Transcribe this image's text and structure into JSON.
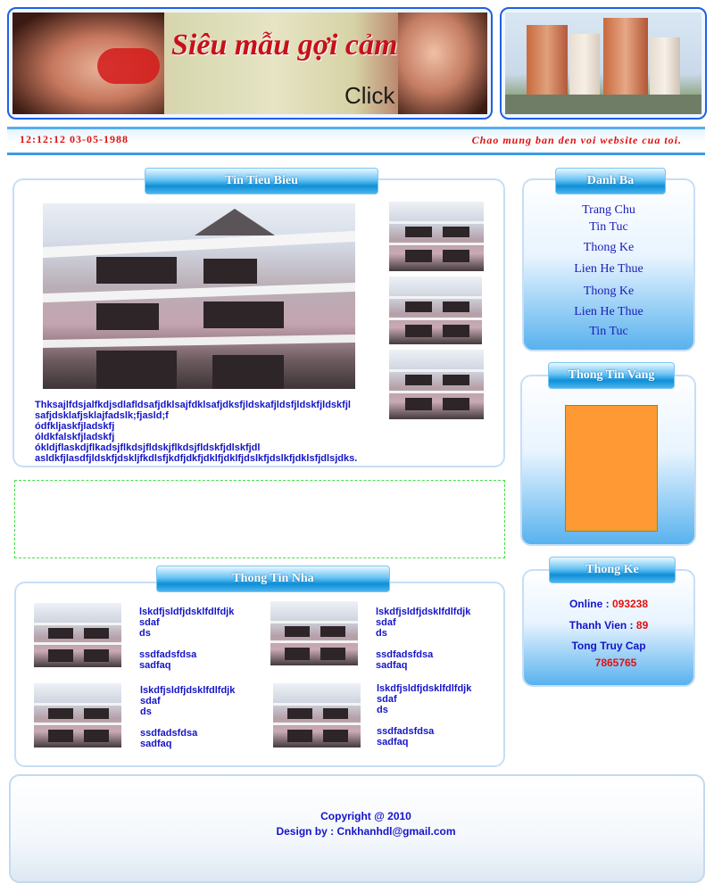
{
  "header": {
    "banner_title": "Siêu mẫu gợi cảm",
    "banner_click": "Click",
    "clock": "12:12:12 03-05-1988",
    "marquee": "Chao mung ban den voi website cua toi."
  },
  "featured": {
    "title": "Tin Tieu Bieu",
    "lines": [
      "Thksajlfdsjalfkdjsdlafldsafjdklsajfdklsafjdksfjldskafjldsfjldskfjldskfjl",
      "safjdsklafjsklajfadslk;fjasld;f",
      "ódfkljaskfjladskfj",
      "óldkfalskfjladskfj",
      "ókldjflaskdjflkadsjflkdsjfldskjflkdsjfldskfjdlskfjdl",
      "asldkfjlasdfjldskfjdskljfkdlsfjkdfjdkfjdklfjdklfjdslkfjdslkfjdklsfjdlsjdks."
    ]
  },
  "houses": {
    "title": "Thong Tin Nha",
    "items": [
      {
        "l1": "lskdfjsldfjdsklfdlfdjk",
        "l2": "sdaf",
        "l3": "ds",
        "l4": "ssdfadsfdsa",
        "l5": "sadfaq"
      },
      {
        "l1": "lskdfjsldfjdsklfdlfdjk",
        "l2": "sdaf",
        "l3": "ds",
        "l4": "ssdfadsfdsa",
        "l5": "sadfaq"
      },
      {
        "l1": "lskdfjsldfjdsklfdlfdjk",
        "l2": "sdaf",
        "l3": "ds",
        "l4": "ssdfadsfdsa",
        "l5": "sadfaq"
      },
      {
        "l1": "lskdfjsldfjdsklfdlfdjk",
        "l2": "sdaf",
        "l3": "ds",
        "l4": "ssdfadsfdsa",
        "l5": "sadfaq"
      }
    ]
  },
  "directory": {
    "title": "Danh Ba",
    "links": [
      "Trang Chu",
      "Tin Tuc",
      "Thong Ke",
      "Lien He Thue",
      "Thong Ke",
      "Lien He Thue",
      "Tin Tuc"
    ]
  },
  "yellow_pages": {
    "title": "Thong Tin Vang",
    "ad_color": "#ff9933"
  },
  "stats": {
    "title": "Thong Ke",
    "online_label": "Online :",
    "online_value": "093238",
    "members_label": "Thanh Vien :",
    "members_value": "89",
    "total_label": "Tong Truy Cap",
    "total_value": "7865765"
  },
  "footer": {
    "copyright": "Copyright @ 2010",
    "design": "Design by : Cnkhanhdl@gmail.com"
  },
  "colors": {
    "frame_blue": "#1f5fe8",
    "link_blue": "#1c1cb8",
    "text_blue": "#1414c8",
    "accent_red": "#e01010"
  }
}
